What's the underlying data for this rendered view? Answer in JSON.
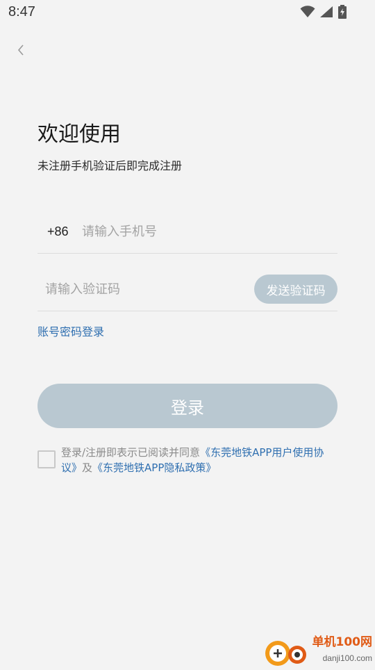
{
  "status_bar": {
    "time": "8:47",
    "icons": [
      "wifi-icon",
      "cellular-signal-icon",
      "battery-charging-icon"
    ]
  },
  "nav": {
    "back_icon": "chevron-left-icon"
  },
  "header": {
    "title": "欢迎使用",
    "subtitle": "未注册手机验证后即完成注册"
  },
  "phone": {
    "country_code": "+86",
    "placeholder": "请输入手机号",
    "value": ""
  },
  "code": {
    "placeholder": "请输入验证码",
    "value": "",
    "send_label": "发送验证码"
  },
  "account_login_label": "账号密码登录",
  "login_label": "登录",
  "agreement": {
    "checked": false,
    "prefix": "登录/注册即表示已阅读并同意",
    "user_agreement": "《东莞地铁APP用户使用协议》",
    "middle": "及",
    "privacy_policy": "《东莞地铁APP隐私政策》"
  },
  "watermark": {
    "name": "单机100网",
    "url": "danji100.com"
  },
  "colors": {
    "background": "#f3f3f3",
    "link": "#2f6fb0",
    "button_disabled": "#b9c8d1",
    "watermark_orange": "#e05b16"
  }
}
